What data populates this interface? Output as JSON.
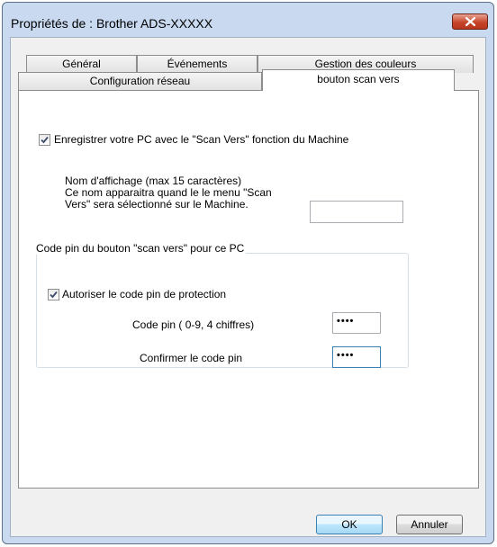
{
  "window": {
    "title": "Propriétés de : Brother ADS-XXXXX"
  },
  "tabs": {
    "general": "Général",
    "events": "Événements",
    "color_management": "Gestion des couleurs",
    "network_config": "Configuration réseau",
    "scan_to_button": "bouton scan vers"
  },
  "panel": {
    "register_checkbox": {
      "label": "Enregistrer votre PC avec le \"Scan Vers\" fonction du Machine",
      "checked": true
    },
    "display_name": {
      "line1": "Nom d'affichage (max 15 caractères)",
      "line2": "Ce nom apparaitra quand le le menu \"Scan",
      "line3": "Vers\" sera sélectionné sur le Machine.",
      "value": ""
    },
    "pin_group": {
      "title": "Code pin du bouton \"scan vers\" pour ce PC",
      "enable_checkbox": {
        "label": "Autoriser le code pin de protection",
        "checked": true
      },
      "pin_label": "Code pin ( 0-9, 4 chiffres)",
      "pin_value": "••••",
      "confirm_label": "Confirmer le code pin",
      "confirm_value": "••••"
    }
  },
  "buttons": {
    "ok": "OK",
    "cancel": "Annuler"
  },
  "colors": {
    "title_bar": "#c9daf0",
    "close_button": "#c6462a",
    "default_button_border": "#3c7fb1"
  }
}
